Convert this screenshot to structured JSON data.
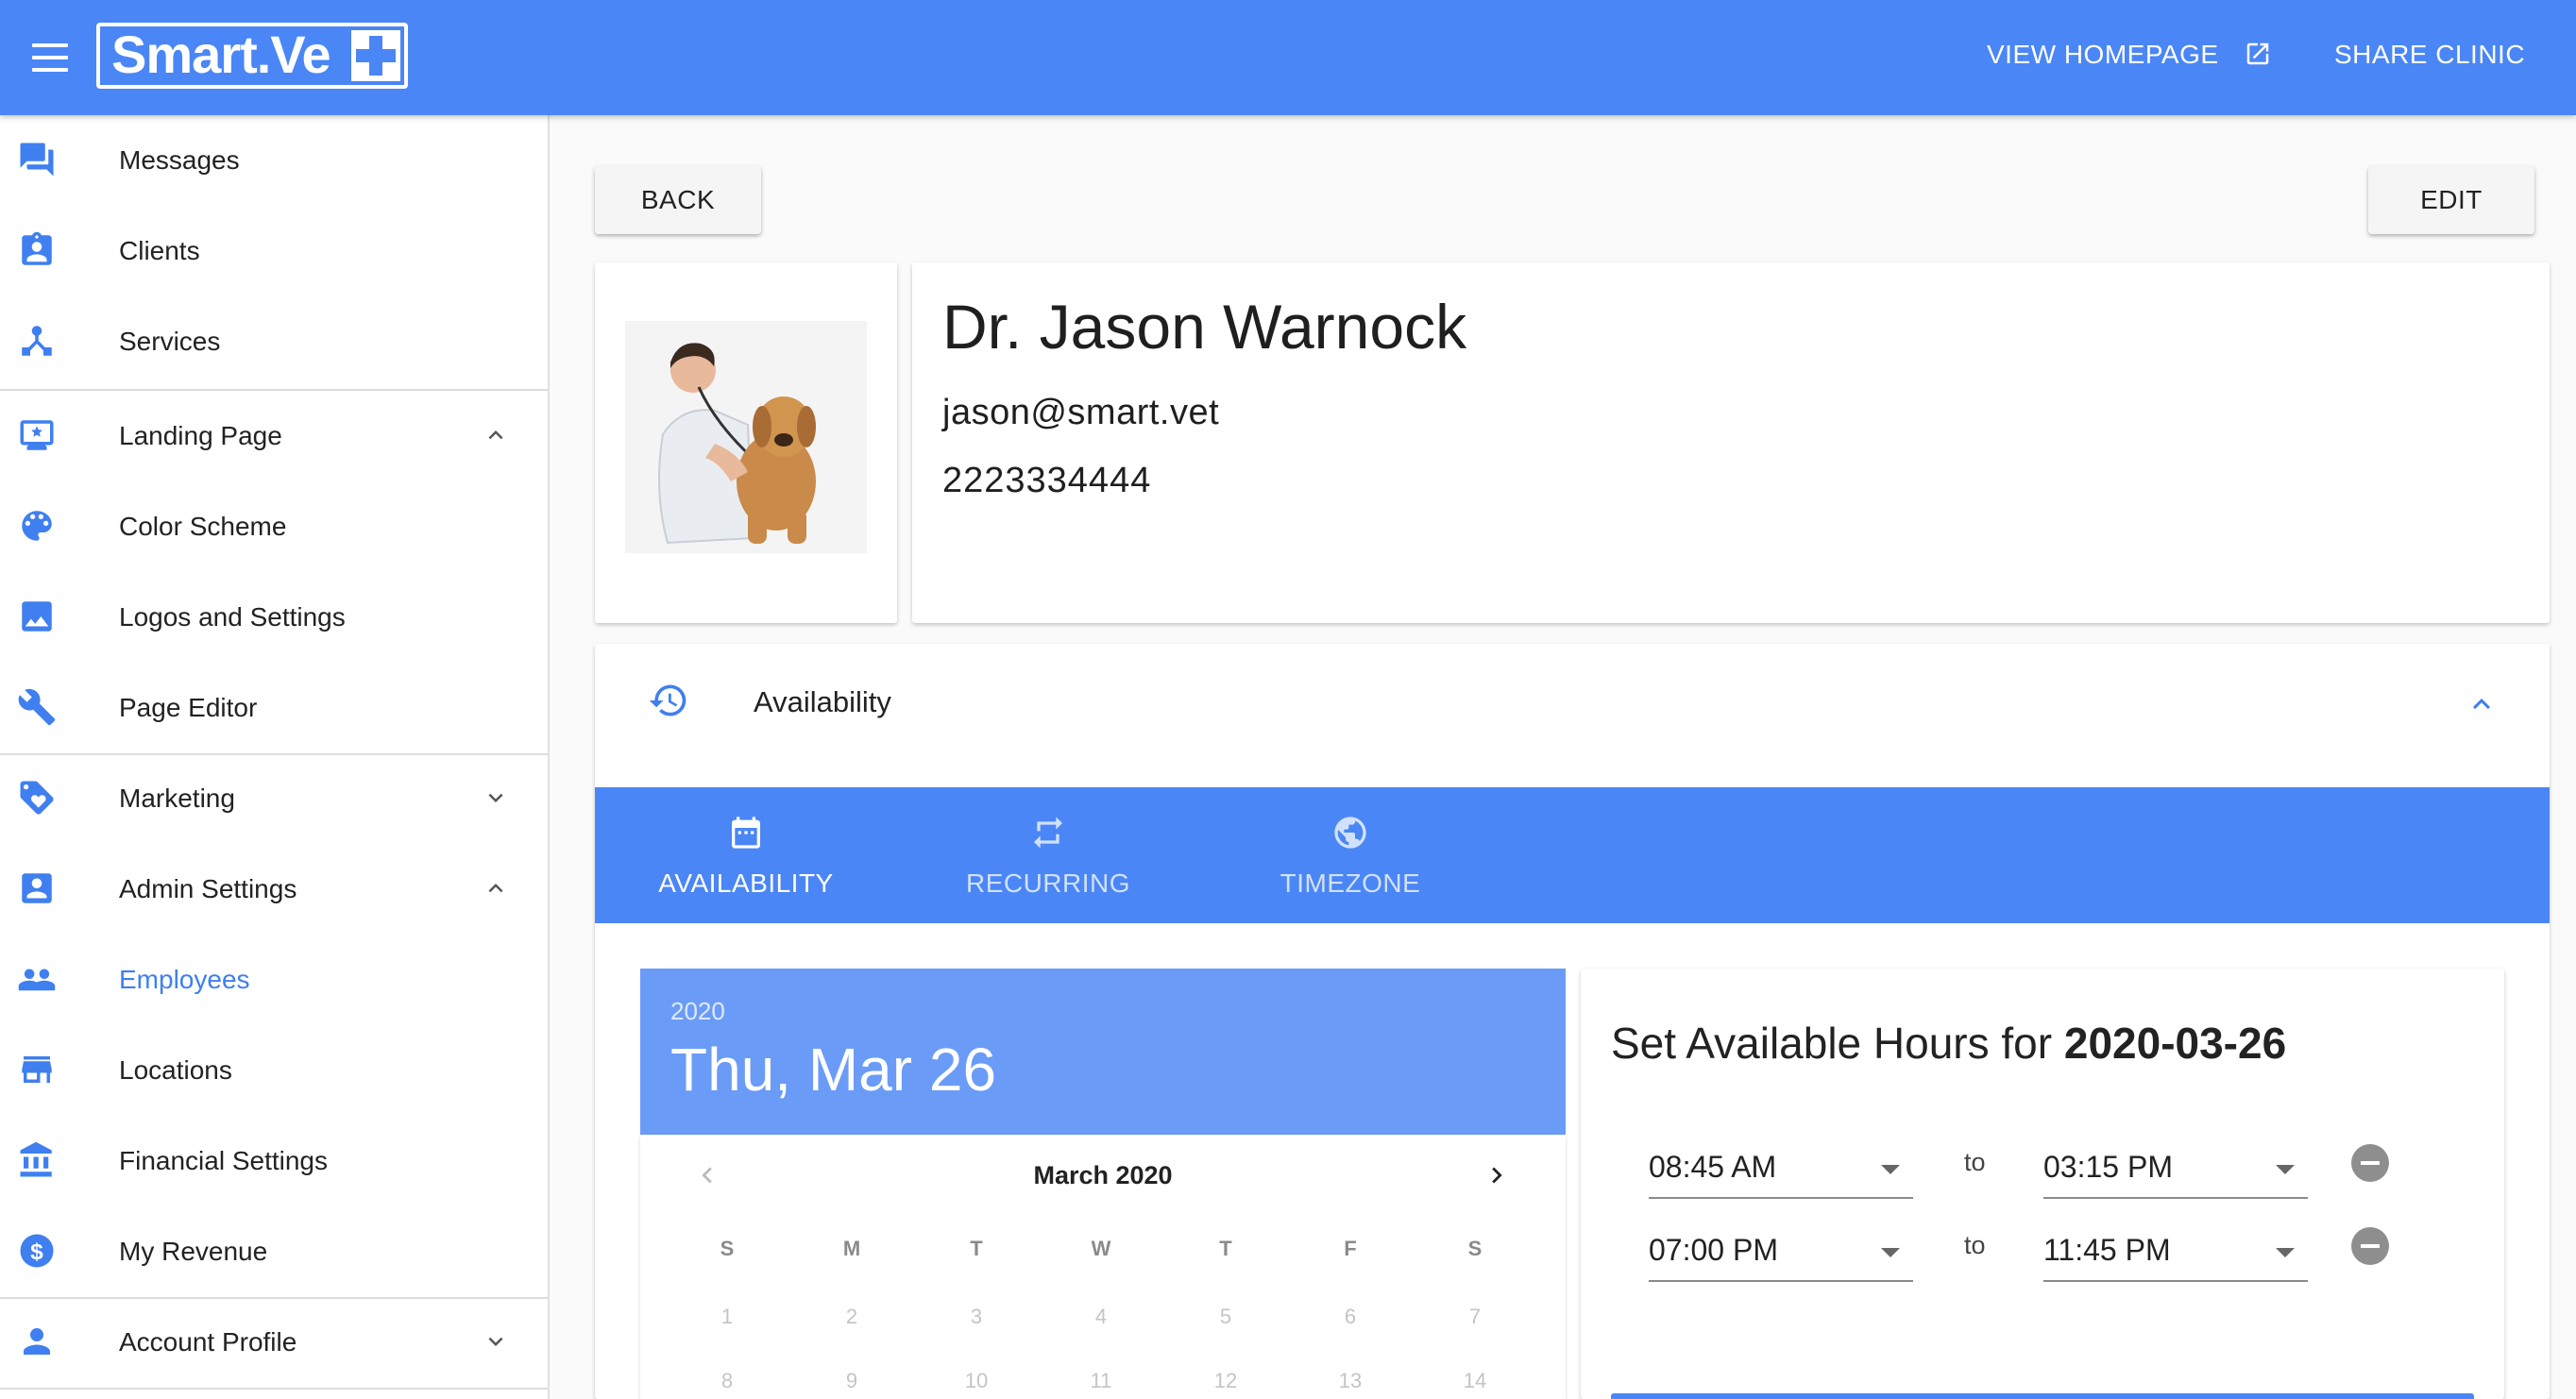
{
  "header": {
    "logo_text": "Smart.Ve",
    "view_homepage": "VIEW HOMEPAGE",
    "share_clinic": "SHARE CLINIC"
  },
  "sidebar": {
    "items": [
      {
        "label": "Messages",
        "icon": "messages-icon"
      },
      {
        "label": "Clients",
        "icon": "clients-icon"
      },
      {
        "label": "Services",
        "icon": "services-icon"
      },
      {
        "label": "Landing Page",
        "icon": "landing-page-icon",
        "expanded": true
      },
      {
        "label": "Color Scheme",
        "icon": "palette-icon"
      },
      {
        "label": "Logos and Settings",
        "icon": "image-icon"
      },
      {
        "label": "Page Editor",
        "icon": "wrench-icon"
      },
      {
        "label": "Marketing",
        "icon": "tag-icon",
        "expanded": false
      },
      {
        "label": "Admin Settings",
        "icon": "admin-icon",
        "expanded": true
      },
      {
        "label": "Employees",
        "icon": "people-icon",
        "active": true
      },
      {
        "label": "Locations",
        "icon": "store-icon"
      },
      {
        "label": "Financial Settings",
        "icon": "bank-icon"
      },
      {
        "label": "My Revenue",
        "icon": "dollar-icon"
      },
      {
        "label": "Account Profile",
        "icon": "person-icon",
        "expanded": false
      }
    ]
  },
  "actions": {
    "back_label": "BACK",
    "edit_label": "EDIT"
  },
  "employee": {
    "name": "Dr. Jason Warnock",
    "email": "jason@smart.vet",
    "phone": "2223334444"
  },
  "availability": {
    "section_title": "Availability",
    "tabs": [
      {
        "label": "AVAILABILITY",
        "icon": "calendar-icon",
        "active": true
      },
      {
        "label": "RECURRING",
        "icon": "repeat-icon",
        "active": false
      },
      {
        "label": "TIMEZONE",
        "icon": "globe-icon",
        "active": false
      }
    ],
    "calendar": {
      "year": "2020",
      "selected_date": "Thu, Mar 26",
      "month_label": "March 2020",
      "weekdays": [
        "S",
        "M",
        "T",
        "W",
        "T",
        "F",
        "S"
      ],
      "weeks": [
        [
          "1",
          "2",
          "3",
          "4",
          "5",
          "6",
          "7"
        ],
        [
          "8",
          "9",
          "10",
          "11",
          "12",
          "13",
          "14"
        ]
      ]
    },
    "hours": {
      "title_prefix": "Set Available Hours for ",
      "title_date": "2020-03-26",
      "to_label": "to",
      "ranges": [
        {
          "from": "08:45 AM",
          "to": "03:15 PM"
        },
        {
          "from": "07:00 PM",
          "to": "11:45 PM"
        }
      ]
    }
  },
  "colors": {
    "primary": "#4a86f5",
    "calendar_header": "#6a9cf7",
    "active_nav": "#3f7ff0",
    "icon_blue": "#3f7ff0"
  }
}
